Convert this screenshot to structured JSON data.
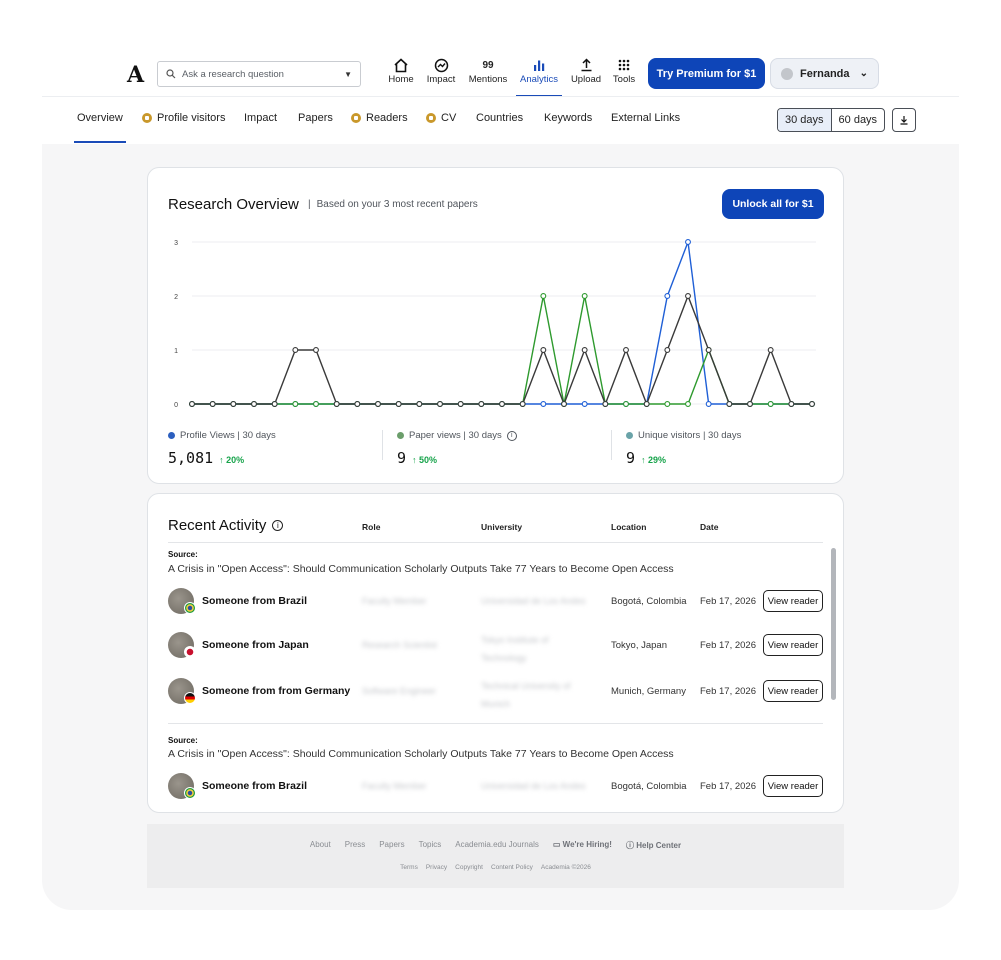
{
  "topnav": {
    "logo": "A",
    "search_placeholder": "Ask a research question",
    "items": [
      {
        "label": "Home",
        "icon": "home-icon"
      },
      {
        "label": "Impact",
        "icon": "impact-icon"
      },
      {
        "label": "Mentions",
        "icon": "mentions-icon",
        "glyph": "99"
      },
      {
        "label": "Analytics",
        "icon": "analytics-icon",
        "active": true
      },
      {
        "label": "Upload",
        "icon": "upload-icon"
      },
      {
        "label": "Tools",
        "icon": "tools-icon"
      }
    ],
    "premium_label": "Try Premium for $1",
    "user_name": "Fernanda"
  },
  "tabs": [
    {
      "label": "Overview",
      "locked": false,
      "active": true
    },
    {
      "label": "Profile visitors",
      "locked": true
    },
    {
      "label": "Impact",
      "locked": false
    },
    {
      "label": "Papers",
      "locked": false
    },
    {
      "label": "Readers",
      "locked": true
    },
    {
      "label": "CV",
      "locked": true
    },
    {
      "label": "Countries",
      "locked": false
    },
    {
      "label": "Keywords",
      "locked": false
    },
    {
      "label": "External Links",
      "locked": false
    }
  ],
  "range": {
    "opt1": "30 days",
    "opt2": "60 days",
    "selected": "30 days"
  },
  "overview": {
    "title": "Research Overview",
    "subtitle": "Based on your 3 most recent papers",
    "unlock_label": "Unlock all for $1",
    "metrics": [
      {
        "label": "Profile Views | 30 days",
        "value": "5,081",
        "change": "20%",
        "color": "#2c5fbf"
      },
      {
        "label": "Paper views | 30 days",
        "value": "9",
        "change": "50%",
        "color": "#6b9e6b",
        "info": true
      },
      {
        "label": "Unique visitors | 30 days",
        "value": "9",
        "change": "29%",
        "color": "#6aa3a8"
      }
    ]
  },
  "chart_data": {
    "type": "line",
    "y_ticks": [
      "0",
      "1",
      "2",
      "3"
    ],
    "ylim": [
      0,
      3
    ],
    "x": [
      1,
      2,
      3,
      4,
      5,
      6,
      7,
      8,
      9,
      10,
      11,
      12,
      13,
      14,
      15,
      16,
      17,
      18,
      19,
      20,
      21,
      22,
      23,
      24,
      25,
      26,
      27,
      28,
      29,
      30,
      31
    ],
    "grid": true,
    "series": [
      {
        "color": "#1f5fd6",
        "values": [
          0,
          0,
          0,
          0,
          0,
          0,
          0,
          0,
          0,
          0,
          0,
          0,
          0,
          0,
          0,
          0,
          0,
          0,
          0,
          0,
          0,
          0,
          0,
          2,
          3,
          0,
          0,
          0,
          0,
          0,
          0
        ]
      },
      {
        "color": "#2e9a2e",
        "values": [
          0,
          0,
          0,
          0,
          0,
          0,
          0,
          0,
          0,
          0,
          0,
          0,
          0,
          0,
          0,
          0,
          0,
          2,
          0,
          2,
          0,
          0,
          0,
          0,
          0,
          1,
          0,
          0,
          0,
          0,
          0
        ]
      },
      {
        "color": "#3a3a3a",
        "values": [
          0,
          0,
          0,
          0,
          0,
          1,
          1,
          0,
          0,
          0,
          0,
          0,
          0,
          0,
          0,
          0,
          0,
          1,
          0,
          1,
          0,
          1,
          0,
          1,
          2,
          1,
          0,
          0,
          1,
          0,
          0
        ]
      }
    ]
  },
  "activity": {
    "title": "Recent Activity",
    "columns": {
      "role": "Role",
      "university": "University",
      "location": "Location",
      "date": "Date"
    },
    "source_label": "Source:",
    "groups": [
      {
        "source": "A Crisis in \"Open Access\": Should Communication Scholarly Outputs Take 77 Years to Become Open Access",
        "rows": [
          {
            "who": "Someone from Brazil",
            "role": "Faculty Member",
            "university": "Universidad de Los Andes",
            "location": "Bogotá, Colombia",
            "date": "Feb 17, 2026",
            "flag": "brazil-flag-icon"
          },
          {
            "who": "Someone from Japan",
            "role": "Research Scientist",
            "university": "Tokyo Institute of Technology",
            "location": "Tokyo, Japan",
            "date": "Feb 17, 2026",
            "flag": "japan-flag-icon"
          },
          {
            "who": "Someone from from Germany",
            "role": "Software Engineer",
            "university": "Technical University of Munich",
            "location": "Munich, Germany",
            "date": "Feb 17, 2026",
            "flag": "germany-flag-icon"
          }
        ]
      },
      {
        "source": "A Crisis in \"Open Access\": Should Communication Scholarly Outputs Take 77 Years to Become Open Access",
        "rows": [
          {
            "who": "Someone from Brazil",
            "role": "Faculty Member",
            "university": "Universidad de Los Andes",
            "location": "Bogotá, Colombia",
            "date": "Feb 17, 2026",
            "flag": "brazil-flag-icon"
          }
        ]
      }
    ],
    "view_label": "View reader"
  },
  "footer": {
    "links": [
      "About",
      "Press",
      "Papers",
      "Topics",
      "Academia.edu Journals",
      "We're Hiring!",
      "Help Center"
    ],
    "sublinks": [
      "Terms",
      "Privacy",
      "Copyright",
      "Content Policy",
      "Academia ©2026"
    ]
  }
}
